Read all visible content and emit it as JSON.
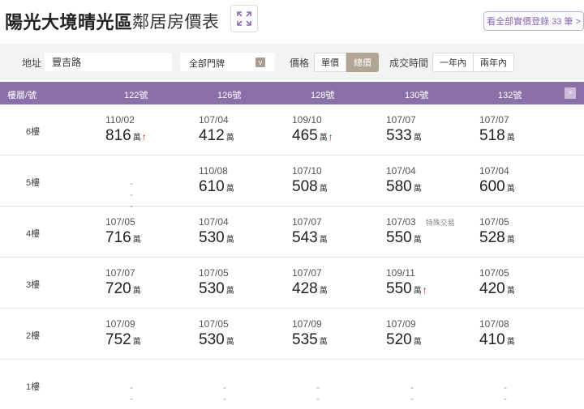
{
  "header": {
    "title": "陽光大境晴光區",
    "subtitle": "鄰居房價表",
    "expand_icon": "expand-arrows-icon",
    "all_records_label": "看全部實價登錄 33 筆 >"
  },
  "filters": {
    "address_label": "地址",
    "address_value": "豐吉路",
    "door_select_value": "全部門牌",
    "price_label": "價格",
    "price_options": [
      "單價",
      "總價"
    ],
    "price_selected": "總價",
    "time_label": "成交時間",
    "time_options": [
      "一年內",
      "兩年內"
    ]
  },
  "table": {
    "floor_header": "樓層/號",
    "columns": [
      "122號",
      "126號",
      "128號",
      "130號",
      "132號"
    ],
    "next_label": ">",
    "unit": "萬",
    "empty_mark": "---",
    "special_label": "特殊交易",
    "rows": [
      {
        "floor": "6樓",
        "cells": [
          {
            "date": "110/02",
            "price": "816",
            "up": true
          },
          {
            "date": "107/04",
            "price": "412"
          },
          {
            "date": "109/10",
            "price": "465",
            "up": true
          },
          {
            "date": "107/07",
            "price": "533"
          },
          {
            "date": "107/07",
            "price": "518"
          }
        ]
      },
      {
        "floor": "5樓",
        "cells": [
          {
            "empty": true
          },
          {
            "date": "110/08",
            "price": "610"
          },
          {
            "date": "107/10",
            "price": "508"
          },
          {
            "date": "107/04",
            "price": "580"
          },
          {
            "date": "107/04",
            "price": "600"
          }
        ]
      },
      {
        "floor": "4樓",
        "cells": [
          {
            "date": "107/05",
            "price": "716"
          },
          {
            "date": "107/04",
            "price": "530"
          },
          {
            "date": "107/07",
            "price": "543"
          },
          {
            "date": "107/03",
            "price": "550",
            "special": true
          },
          {
            "date": "107/05",
            "price": "528"
          }
        ]
      },
      {
        "floor": "3樓",
        "cells": [
          {
            "date": "107/07",
            "price": "720"
          },
          {
            "date": "107/05",
            "price": "530"
          },
          {
            "date": "107/07",
            "price": "428"
          },
          {
            "date": "109/11",
            "price": "550",
            "up": true
          },
          {
            "date": "107/05",
            "price": "420"
          }
        ]
      },
      {
        "floor": "2樓",
        "cells": [
          {
            "date": "107/09",
            "price": "752"
          },
          {
            "date": "107/05",
            "price": "530"
          },
          {
            "date": "107/09",
            "price": "535"
          },
          {
            "date": "107/09",
            "price": "520"
          },
          {
            "date": "107/08",
            "price": "410"
          }
        ]
      },
      {
        "floor": "1樓",
        "cells": [
          {
            "empty": true
          },
          {
            "empty": true
          },
          {
            "empty": true
          },
          {
            "empty": true
          },
          {
            "empty": true
          }
        ]
      }
    ]
  },
  "colors": {
    "header_bg": "#8a6fa8",
    "active_seg": "#b2a596",
    "up_arrow": "#e00000",
    "link": "#8a6bb0"
  }
}
